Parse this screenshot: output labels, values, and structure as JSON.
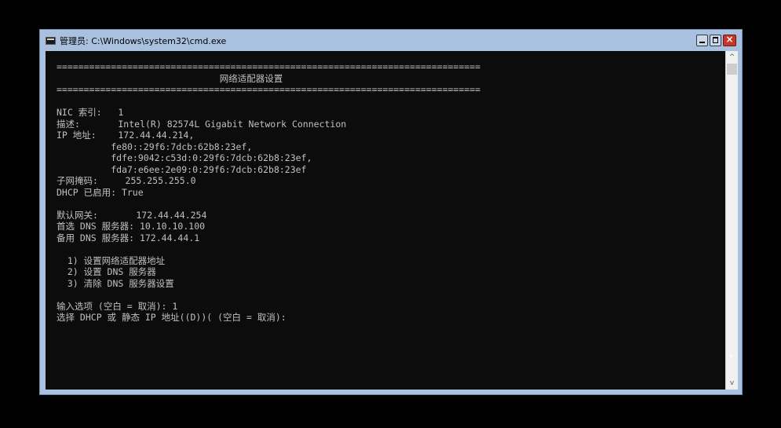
{
  "window": {
    "title": "管理员: C:\\Windows\\system32\\cmd.exe",
    "icon": "cmd-icon",
    "controls": {
      "minimize_icon": "minimize-icon",
      "maximize_icon": "maximize-icon",
      "close_icon": "close-icon",
      "close_glyph": "×"
    }
  },
  "console": {
    "lines": [
      "==============================================================================",
      "                              网络适配器设置",
      "==============================================================================",
      "",
      "NIC 索引:   1",
      "描述:       Intel(R) 82574L Gigabit Network Connection",
      "IP 地址:    172.44.44.214,",
      "          fe80::29f6:7dcb:62b8:23ef,",
      "          fdfe:9042:c53d:0:29f6:7dcb:62b8:23ef,",
      "          fda7:e6ee:2e09:0:29f6:7dcb:62b8:23ef",
      "子网掩码:     255.255.255.0",
      "DHCP 已启用: True",
      "",
      "默认网关:       172.44.44.254",
      "首选 DNS 服务器: 10.10.10.100",
      "备用 DNS 服务器: 172.44.44.1",
      "",
      "  1) 设置网络适配器地址",
      "  2) 设置 DNS 服务器",
      "  3) 清除 DNS 服务器设置",
      "",
      "输入选项 (空白 = 取消): 1",
      "选择 DHCP 或 静态 IP 地址((D))( (空白 = 取消):"
    ],
    "text_color": "#c0c0c0",
    "background_color": "#0c0c0c"
  },
  "scrollbar": {
    "up_glyph": "^",
    "down_glyph": "v"
  },
  "colors": {
    "titlebar": "#a9c1de",
    "close_button": "#c7362b"
  }
}
